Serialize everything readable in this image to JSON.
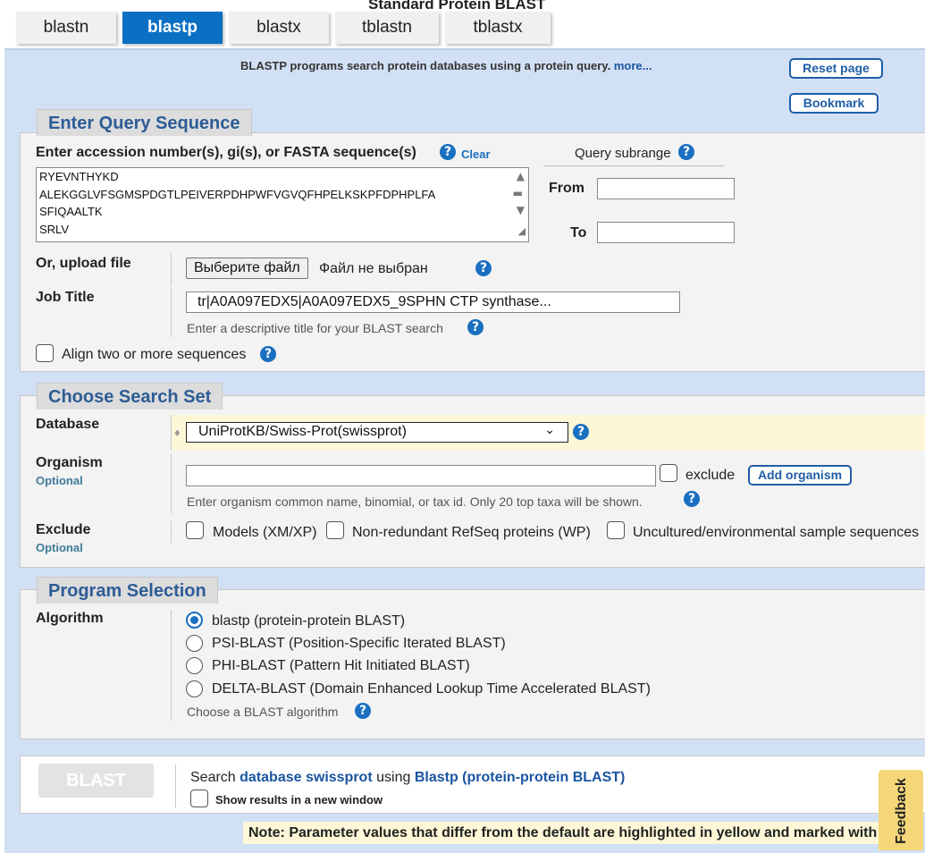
{
  "page": {
    "title": "Standard Protein BLAST"
  },
  "tabs": [
    {
      "label": "blastn",
      "active": false
    },
    {
      "label": "blastp",
      "active": true
    },
    {
      "label": "blastx",
      "active": false
    },
    {
      "label": "tblastn",
      "active": false
    },
    {
      "label": "tblastx",
      "active": false
    }
  ],
  "intro": {
    "text": "BLASTP programs search protein databases using a protein query.",
    "more_link": "more..."
  },
  "header_buttons": {
    "reset": "Reset page",
    "bookmark": "Bookmark"
  },
  "query_section": {
    "legend": "Enter Query Sequence",
    "input_label": "Enter accession number(s), gi(s), or FASTA sequence(s)",
    "clear_link": "Clear",
    "sequence_lines": [
      "RYEVNTHYKD",
      "ALEKGGLVFSGMSPDGTLPEIVERPDHPWFVGVQFHPELKSKPFDPHPLFA",
      "SFIQAALTK",
      "SRLV"
    ],
    "subrange_title": "Query subrange",
    "from_label": "From",
    "from_value": "",
    "to_label": "To",
    "to_value": "",
    "upload_label": "Or, upload file",
    "upload_button": "Выберите файл",
    "upload_status": "Файл не выбран",
    "job_title_label": "Job Title",
    "job_title_value": "tr|A0A097EDX5|A0A097EDX5_9SPHN CTP synthase...",
    "job_title_hint": "Enter a descriptive title for your BLAST search",
    "align_label": "Align two or more sequences"
  },
  "search_set": {
    "legend": "Choose Search Set",
    "database_label": "Database",
    "database_marker": "♦",
    "database_value": "UniProtKB/Swiss-Prot(swissprot)",
    "organism_label": "Organism",
    "organism_optional": "Optional",
    "organism_value": "",
    "exclude_checkbox_label": "exclude",
    "add_organism_button": "Add organism",
    "organism_hint": "Enter organism common name, binomial, or tax id. Only 20 top taxa will be shown.",
    "exclude_label": "Exclude",
    "exclude_optional": "Optional",
    "exclude_options": [
      "Models (XM/XP)",
      "Non-redundant RefSeq proteins (WP)",
      "Uncultured/environmental sample sequences"
    ]
  },
  "program": {
    "legend": "Program Selection",
    "algorithm_label": "Algorithm",
    "options": [
      {
        "label": "blastp (protein-protein BLAST)",
        "checked": true
      },
      {
        "label": "PSI-BLAST (Position-Specific Iterated BLAST)",
        "checked": false
      },
      {
        "label": "PHI-BLAST (Pattern Hit Initiated BLAST)",
        "checked": false
      },
      {
        "label": "DELTA-BLAST (Domain Enhanced Lookup Time Accelerated BLAST)",
        "checked": false
      }
    ],
    "hint": "Choose a BLAST algorithm"
  },
  "submit": {
    "button": "BLAST",
    "search_prefix": "Search",
    "search_db": "database swissprot",
    "search_mid": "using",
    "search_algo": "Blastp (protein-protein BLAST)",
    "new_window_label": "Show results in a new window"
  },
  "note": "Note: Parameter values that differ from the default are highlighted in yellow and marked with ♦ sign",
  "feedback": "Feedback",
  "help_glyph": "?",
  "colors": {
    "accent": "#0b6fc3",
    "legend_text": "#2d5c96",
    "highlight": "#fdf7d8",
    "feedback": "#f5d77a"
  }
}
